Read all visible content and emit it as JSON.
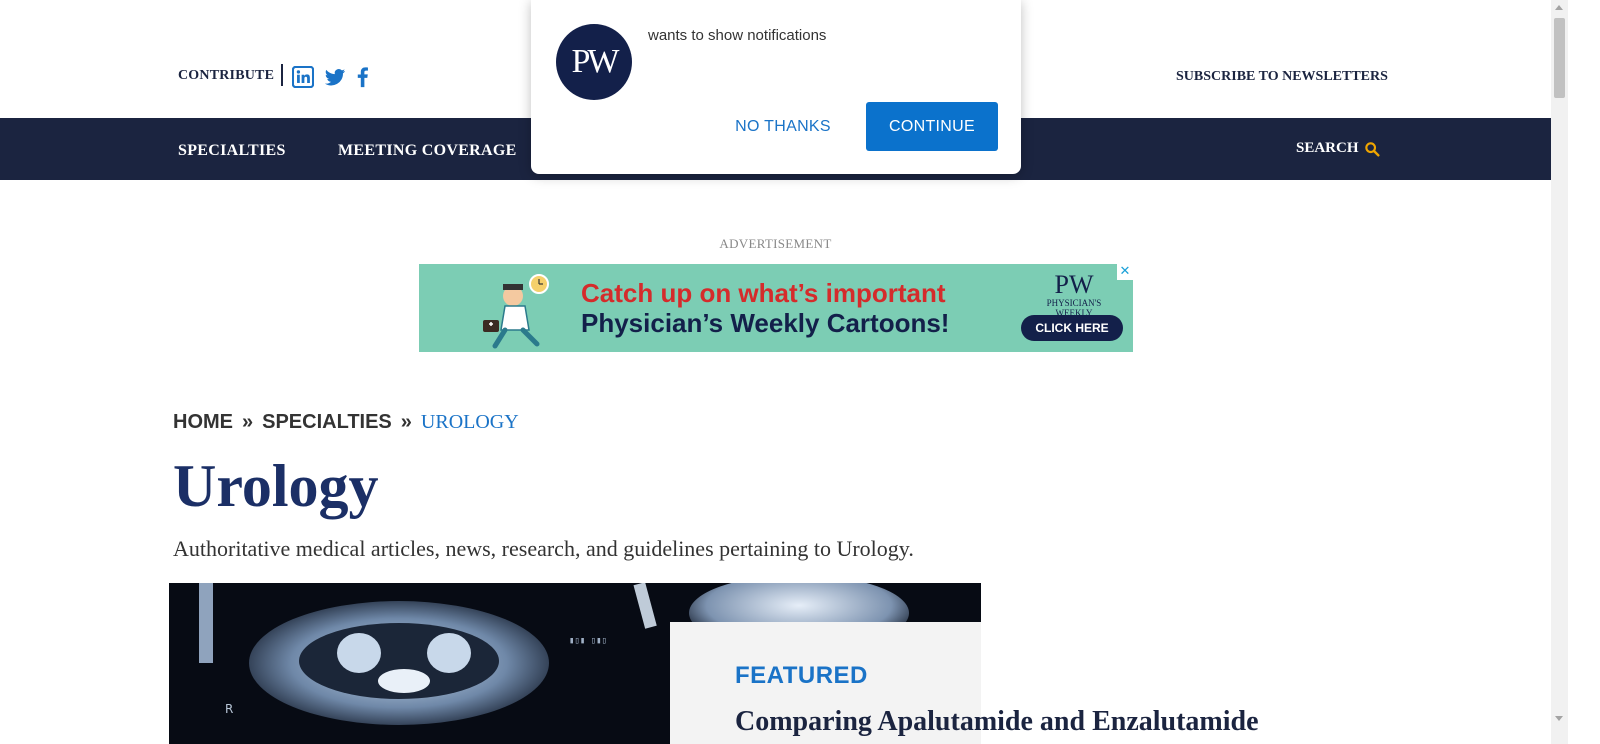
{
  "header": {
    "contribute_label": "CONTRIBUTE",
    "social_icons": [
      "linkedin-icon",
      "twitter-icon",
      "facebook-icon"
    ],
    "subscribe_label": "SUBSCRIBE TO NEWSLETTERS"
  },
  "nav": {
    "items": [
      "SPECIALTIES",
      "MEETING COVERAGE"
    ],
    "search_label": "SEARCH",
    "search_icon": "magnifier-icon"
  },
  "ad": {
    "label": "ADVERTISEMENT",
    "headline": "Catch up on what’s important",
    "subheadline": "Physician’s Weekly Cartoons!",
    "logo_mark": "PW",
    "logo_text": "PHYSICIAN'S WEEKLY",
    "cta": "CLICK HERE",
    "close": "✕"
  },
  "breadcrumb": {
    "home": "HOME",
    "sep": "»",
    "specialties": "SPECIALTIES",
    "current": "UROLOGY"
  },
  "page": {
    "title": "Urology",
    "description": "Authoritative medical articles, news, research, and guidelines pertaining to Urology."
  },
  "featured": {
    "label": "FEATURED",
    "title": "Comparing Apalutamide and Enzalutamide"
  },
  "notification": {
    "logo": "PW",
    "message": "wants to show notifications",
    "decline": "NO THANKS",
    "accept": "CONTINUE"
  },
  "colors": {
    "navy": "#1b2440",
    "accent_blue": "#1a73c7",
    "search_icon": "#f0a500",
    "ad_bg": "#7ccdb4",
    "ad_red": "#d52b2b"
  }
}
